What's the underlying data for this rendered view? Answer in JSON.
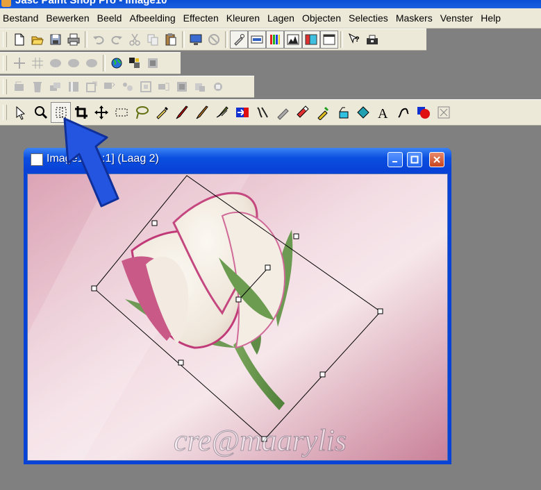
{
  "app": {
    "title": "Jasc Paint Shop Pro - Image10"
  },
  "menu": [
    "Bestand",
    "Bewerken",
    "Beeld",
    "Afbeelding",
    "Effecten",
    "Kleuren",
    "Lagen",
    "Objecten",
    "Selecties",
    "Maskers",
    "Venster",
    "Help"
  ],
  "document_window": {
    "title": "Image10 [1:1] (Laag 2)",
    "controls": [
      "minimize",
      "maximize",
      "close"
    ]
  },
  "canvas": {
    "watermark": "cre@maarylis",
    "subject": "rose-image"
  },
  "colors": {
    "titlebar": "#0842d6",
    "toolbar_bg": "#ece9d8",
    "workspace": "#808080",
    "arrow": "#1f4fd8",
    "canvas_pink": "#e3b5c4"
  },
  "toolbars": {
    "standard": [
      "new-icon",
      "open-icon",
      "save-icon",
      "print-icon",
      "undo-icon",
      "redo-icon",
      "cut-icon",
      "copy-icon",
      "paste-icon",
      "screen-capture-icon",
      "browse-icon",
      "color-palette-icon",
      "histogram-icon",
      "layer-icon",
      "overview-icon",
      "help-icon",
      "scan-icon"
    ],
    "web": [
      "grid-icon",
      "guides-icon",
      "jpg-icon",
      "gif-icon",
      "png-icon",
      "globe-icon",
      "image-mapper-icon",
      "slicer-icon"
    ],
    "layers": [
      "new-layer-icon",
      "delete-layer-icon",
      "duplicate-layer-icon",
      "layer-props-icon",
      "mask-icon",
      "merge-icon",
      "group-icon",
      "frame-icon",
      "flip-icon",
      "mirror-icon",
      "rotate-icon",
      "arrange-icon"
    ],
    "tools": [
      "arrow-icon",
      "zoom-icon",
      "deform-icon",
      "crop-icon",
      "move-icon",
      "selection-icon",
      "lasso-icon",
      "dropper-icon",
      "paintbrush-icon",
      "clone-icon",
      "retouch-icon",
      "color-replacer-icon",
      "scratch-remover-icon",
      "eraser-icon",
      "picture-tube-icon",
      "airbrush-icon",
      "flood-fill-icon",
      "text-icon",
      "draw-icon",
      "preset-shape-icon",
      "object-selector-icon"
    ]
  }
}
